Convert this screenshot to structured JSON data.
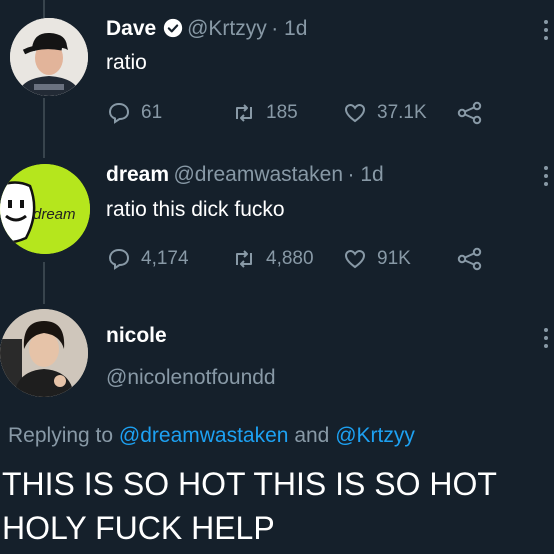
{
  "tweets": [
    {
      "name": "Dave",
      "verified": true,
      "handle": "@Krtzyy",
      "time": "· 1d",
      "text": "ratio",
      "replies": "61",
      "retweets": "185",
      "likes": "37.1K"
    },
    {
      "name": "dream",
      "handle": "@dreamwastaken",
      "time": "· 1d",
      "text": "ratio this dick fucko",
      "avatar_label": "dream",
      "replies": "4,174",
      "retweets": "4,880",
      "likes": "91K"
    }
  ],
  "reply": {
    "name": "nicole",
    "handle": "@nicolenotfoundd",
    "replying_prefix": "Replying to",
    "replying_to_1": "@dreamwastaken",
    "replying_and": "and",
    "replying_to_2": "@Krtzyy",
    "text_line_1": "THIS IS SO HOT THIS IS SO HOT",
    "text_line_2": "HOLY FUCK HELP"
  },
  "colors": {
    "background": "#15202b",
    "muted": "#8899a6",
    "link": "#1da1f2",
    "dream_green": "#b5e61d"
  },
  "icons": [
    "verified-badge-icon",
    "reply-icon",
    "retweet-icon",
    "like-icon",
    "share-icon",
    "more-icon"
  ]
}
